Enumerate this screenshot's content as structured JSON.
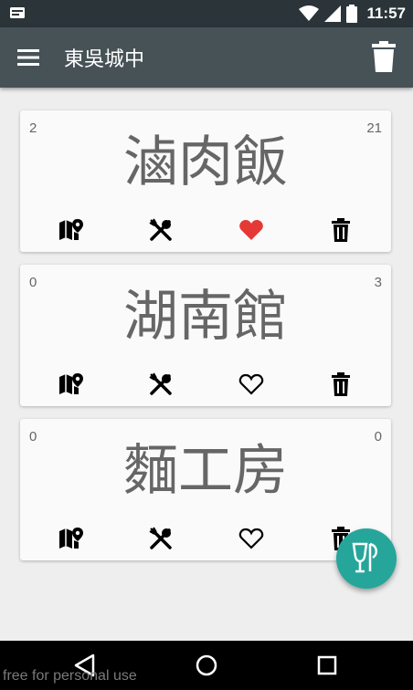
{
  "status_bar": {
    "time": "11:57"
  },
  "app_bar": {
    "title": "東吳城中"
  },
  "cards": [
    {
      "name": "滷肉飯",
      "left_count": "2",
      "right_count": "21",
      "favorite": true
    },
    {
      "name": "湖南館",
      "left_count": "0",
      "right_count": "3",
      "favorite": false
    },
    {
      "name": "麵工房",
      "left_count": "0",
      "right_count": "0",
      "favorite": false
    }
  ],
  "colors": {
    "favorite_active": "#e53935",
    "fab": "#26a69a",
    "app_bar": "#475257",
    "status_bar": "#2b3438"
  },
  "icons": {
    "card_actions": [
      "map-icon",
      "food-icon",
      "heart-icon",
      "delete-icon"
    ],
    "fab": "cup-icon"
  },
  "watermark": "free for personal use"
}
